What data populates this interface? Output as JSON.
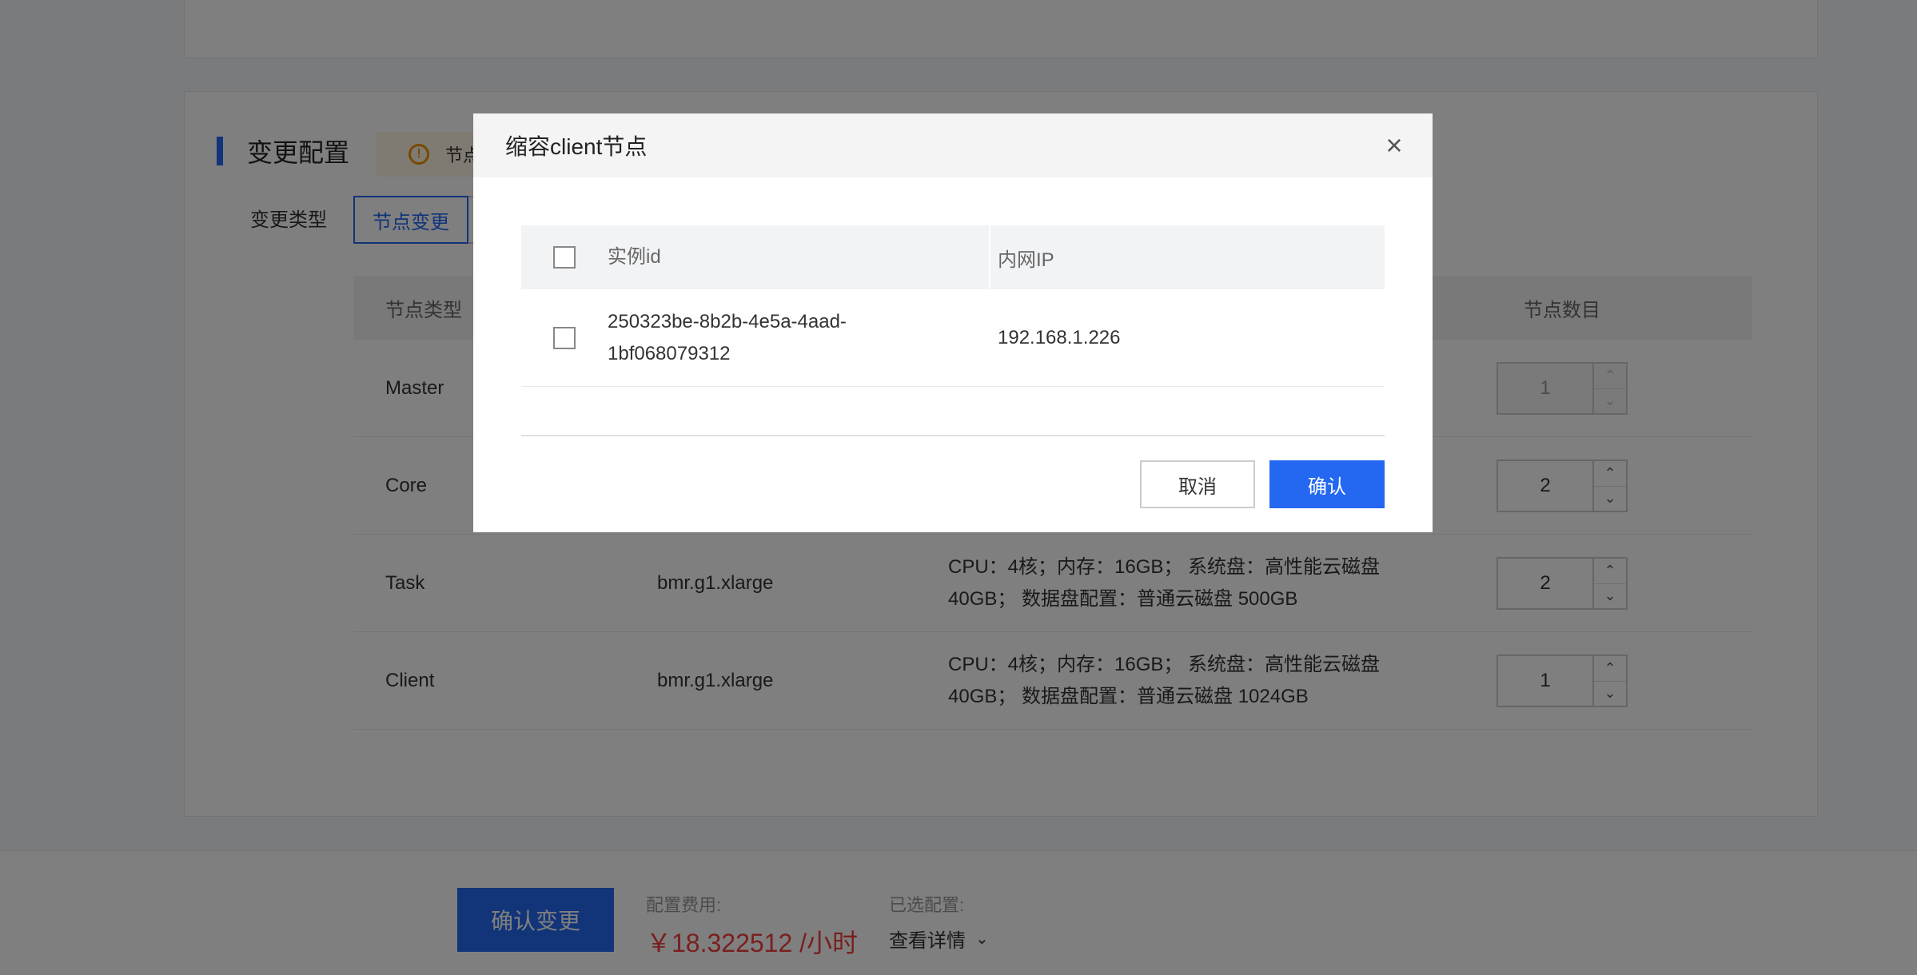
{
  "background": {
    "section_title": "变更配置",
    "notice_text": "节点",
    "change_type_label": "变更类型",
    "change_type_tabs": [
      "节点变更"
    ],
    "nodes_table": {
      "headers": [
        "节点类型",
        "",
        "",
        "节点数目"
      ],
      "rows": [
        {
          "type": "Master",
          "spec": "",
          "config_line1": "",
          "config_line2": "",
          "count": "1"
        },
        {
          "type": "Core",
          "spec": "",
          "config_line1": "",
          "config_line2": "",
          "count": "2"
        },
        {
          "type": "Task",
          "spec": "bmr.g1.xlarge",
          "config_line1": "CPU：4核；内存：16GB； 系统盘：高性能云磁盘",
          "config_line2": "40GB； 数据盘配置：普通云磁盘 500GB",
          "count": "2"
        },
        {
          "type": "Client",
          "spec": "bmr.g1.xlarge",
          "config_line1": "CPU：4核；内存：16GB； 系统盘：高性能云磁盘",
          "config_line2": "40GB； 数据盘配置：普通云磁盘 1024GB",
          "count": "1"
        }
      ]
    },
    "footer": {
      "confirm_button": "确认变更",
      "fee_label": "配置费用:",
      "fee_value": "￥18.322512 /小时",
      "selected_label": "已选配置:",
      "detail_link": "查看详情"
    }
  },
  "modal": {
    "title": "缩容client节点",
    "columns": [
      "实例id",
      "内网IP"
    ],
    "rows": [
      {
        "instance_id_line1": "250323be-8b2b-4e5a-4aad-",
        "instance_id_line2": "1bf068079312",
        "ip": "192.168.1.226"
      }
    ],
    "cancel_label": "取消",
    "ok_label": "确认"
  },
  "colors": {
    "primary": "#2468f2",
    "price": "#f33e3e",
    "warning": "#f39000"
  }
}
